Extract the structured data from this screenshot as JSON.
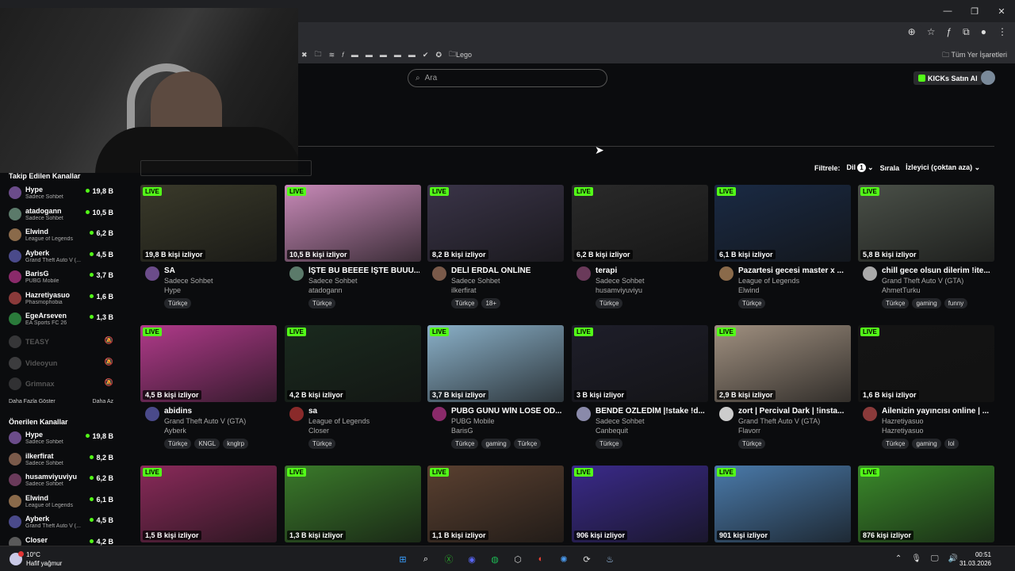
{
  "window": {
    "minimize": "—",
    "maximize": "❐",
    "close": "✕"
  },
  "bookmarks": {
    "items": [
      {
        "icon": "✖"
      },
      {
        "icon": "🗀"
      },
      {
        "icon": "≋"
      },
      {
        "icon": "𝑓"
      },
      {
        "icon": "▬"
      },
      {
        "icon": "▬"
      },
      {
        "icon": "▬"
      },
      {
        "icon": "▬"
      },
      {
        "icon": "▬"
      },
      {
        "icon": "✔"
      },
      {
        "icon": "✪"
      }
    ],
    "folder_label": "Lego",
    "all_bookmarks": "Tüm Yer İşaretleri"
  },
  "header": {
    "search_placeholder": "Ara",
    "buy_kicks": "KICKs Satın Al"
  },
  "filters": {
    "filter_label": "Filtrele:",
    "language_label": "Dil",
    "language_count": "1",
    "sort_label": "Sırala",
    "sort_value": "İzleyici (çoktan aza)"
  },
  "sidebar": {
    "followed_title": "Takip Edilen Kanallar",
    "followed": [
      {
        "name": "Hype",
        "game": "Sadece Sohbet",
        "viewers": "19,8 B",
        "color": "#6b4c8a"
      },
      {
        "name": "atadogann",
        "game": "Sadece Sohbet",
        "viewers": "10,5 B",
        "color": "#5b7a6a"
      },
      {
        "name": "Elwind",
        "game": "League of Legends",
        "viewers": "6,2 B",
        "color": "#8a6a4a"
      },
      {
        "name": "Ayberk",
        "game": "Grand Theft Auto V (...",
        "viewers": "4,5 B",
        "color": "#4a4a8a"
      },
      {
        "name": "BarisG",
        "game": "PUBG Mobile",
        "viewers": "3,7 B",
        "color": "#8a2a6a"
      },
      {
        "name": "Hazretiyasuo",
        "game": "Phasmophobia",
        "viewers": "1,6 B",
        "color": "#8a3a3a"
      },
      {
        "name": "EgeArseven",
        "game": "EA Sports FC 26",
        "viewers": "1,3 B",
        "color": "#2a7a3a"
      }
    ],
    "offline": [
      {
        "name": "TEASY",
        "color": "#888"
      },
      {
        "name": "Videoyun",
        "color": "#999"
      },
      {
        "name": "Grimnax",
        "color": "#777"
      }
    ],
    "show_more": "Daha Fazla Göster",
    "show_less": "Daha Az",
    "recommended_title": "Önerilen Kanallar",
    "recommended": [
      {
        "name": "Hype",
        "game": "Sadece Sohbet",
        "viewers": "19,8 B",
        "color": "#6b4c8a"
      },
      {
        "name": "ilkerfirat",
        "game": "Sadece Sohbet",
        "viewers": "8,2 B",
        "color": "#7a5a4a"
      },
      {
        "name": "husamviyuviyu",
        "game": "Sadece Sohbet",
        "viewers": "6,2 B",
        "color": "#6a3a5a"
      },
      {
        "name": "Elwind",
        "game": "League of Legends",
        "viewers": "6,1 B",
        "color": "#8a6a4a"
      },
      {
        "name": "Ayberk",
        "game": "Grand Theft Auto V (...",
        "viewers": "4,5 B",
        "color": "#4a4a8a"
      },
      {
        "name": "Closer",
        "game": "",
        "viewers": "4,2 B",
        "color": "#5a5a5a"
      }
    ]
  },
  "live_label": "LIVE",
  "streams": [
    {
      "viewers": "19,8 B kişi izliyor",
      "title": "SA",
      "category": "Sadece Sohbet",
      "channel": "Hype",
      "tags": [
        "Türkçe"
      ],
      "thumb": "#3a3a2a",
      "avatar": "#6b4c8a"
    },
    {
      "viewers": "10,5 B kişi izliyor",
      "title": "İŞTE BU BEEEE İŞTE BUUU...",
      "category": "Sadece Sohbet",
      "channel": "atadogann",
      "tags": [
        "Türkçe"
      ],
      "thumb": "#c88ab8",
      "avatar": "#5b7a6a"
    },
    {
      "viewers": "8,2 B kişi izliyor",
      "title": "DELİ ERDAL ONLİNE",
      "category": "Sadece Sohbet",
      "channel": "ilkerfirat",
      "tags": [
        "Türkçe",
        "18+"
      ],
      "thumb": "#3a3448",
      "avatar": "#7a5a4a"
    },
    {
      "viewers": "6,2 B kişi izliyor",
      "title": "terapi",
      "category": "Sadece Sohbet",
      "channel": "husamviyuviyu",
      "tags": [
        "Türkçe"
      ],
      "thumb": "#2a2a2a",
      "avatar": "#6a3a5a"
    },
    {
      "viewers": "6,1 B kişi izliyor",
      "title": "Pazartesi gecesi master x ...",
      "category": "League of Legends",
      "channel": "Elwind",
      "tags": [
        "Türkçe"
      ],
      "thumb": "#1a2a44",
      "avatar": "#8a6a4a"
    },
    {
      "viewers": "5,8 B kişi izliyor",
      "title": "chill gece olsun dilerim !ite...",
      "category": "Grand Theft Auto V (GTA)",
      "channel": "AhmetTurku",
      "tags": [
        "Türkçe",
        "gaming",
        "funny"
      ],
      "thumb": "#4a5048",
      "avatar": "#aaaaaa"
    },
    {
      "viewers": "4,5 B kişi izliyor",
      "title": "abidins",
      "category": "Grand Theft Auto V (GTA)",
      "channel": "Ayberk",
      "tags": [
        "Türkçe",
        "KNGL",
        "knglrp"
      ],
      "thumb": "#b03a8a",
      "avatar": "#4a4a8a"
    },
    {
      "viewers": "4,2 B kişi izliyor",
      "title": "sa",
      "category": "League of Legends",
      "channel": "Closer",
      "tags": [
        "Türkçe"
      ],
      "thumb": "#1a2a1e",
      "avatar": "#8a2a2a"
    },
    {
      "viewers": "3,7 B kişi izliyor",
      "title": "PUBG GÜNÜ WİN LOSE ÖD...",
      "category": "PUBG Mobile",
      "channel": "BarisG",
      "tags": [
        "Türkçe",
        "gaming",
        "Türkçe"
      ],
      "thumb": "#8ab0c8",
      "avatar": "#8a2a6a"
    },
    {
      "viewers": "3 B kişi izliyor",
      "title": "BENDE ÖZLEDİM |!stake !d...",
      "category": "Sadece Sohbet",
      "channel": "Canbequit",
      "tags": [
        "Türkçe"
      ],
      "thumb": "#1e1e2a",
      "avatar": "#8a8aaa"
    },
    {
      "viewers": "2,9 B kişi izliyor",
      "title": "zort | Percival Dark | !insta...",
      "category": "Grand Theft Auto V (GTA)",
      "channel": "Flavorr",
      "tags": [
        "Türkçe"
      ],
      "thumb": "#a09080",
      "avatar": "#cccccc"
    },
    {
      "viewers": "1,6 B kişi izliyor",
      "title": "Ailenizin yayıncısı online | ...",
      "category": "Hazretiyasuo",
      "channel": "Hazretiyasuo",
      "tags": [
        "Türkçe",
        "gaming",
        "lol"
      ],
      "thumb": "#141414",
      "avatar": "#8a3a3a"
    },
    {
      "viewers": "1,5 B kişi izliyor",
      "title": "",
      "category": "",
      "channel": "",
      "tags": [],
      "thumb": "#8a2a5a",
      "avatar": "#555"
    },
    {
      "viewers": "1,3 B kişi izliyor",
      "title": "",
      "category": "",
      "channel": "",
      "tags": [],
      "thumb": "#3a7a2a",
      "avatar": "#555"
    },
    {
      "viewers": "1,1 B kişi izliyor",
      "title": "",
      "category": "",
      "channel": "",
      "tags": [],
      "thumb": "#5a4030",
      "avatar": "#555"
    },
    {
      "viewers": "906 kişi izliyor",
      "title": "",
      "category": "",
      "channel": "",
      "tags": [],
      "thumb": "#3a2a8a",
      "avatar": "#555"
    },
    {
      "viewers": "901 kişi izliyor",
      "title": "",
      "category": "",
      "channel": "",
      "tags": [],
      "thumb": "#4a7aaa",
      "avatar": "#555"
    },
    {
      "viewers": "876 kişi izliyor",
      "title": "",
      "category": "",
      "channel": "",
      "tags": [],
      "thumb": "#3a8a2a",
      "avatar": "#555"
    }
  ],
  "taskbar": {
    "temp": "10°C",
    "weather": "Hafif yağmur",
    "apps": [
      {
        "icon": "⊞",
        "color": "#3aa0ff"
      },
      {
        "icon": "⌕",
        "color": "#ffffff"
      },
      {
        "icon": "Ⓧ",
        "color": "#2aa02a"
      },
      {
        "icon": "◉",
        "color": "#5865f2"
      },
      {
        "icon": "◍",
        "color": "#1db954"
      },
      {
        "icon": "⬡",
        "color": "#cccccc"
      },
      {
        "icon": "◐",
        "color": "#e94235"
      },
      {
        "icon": "✺",
        "color": "#4a9aee"
      },
      {
        "icon": "⟳",
        "color": "#dddddd"
      },
      {
        "icon": "♨",
        "color": "#aad4ff"
      }
    ],
    "tray": [
      "⌃",
      "🎙",
      "🖵",
      "🔊"
    ],
    "time": "00:51",
    "date": "31.03.2026"
  }
}
